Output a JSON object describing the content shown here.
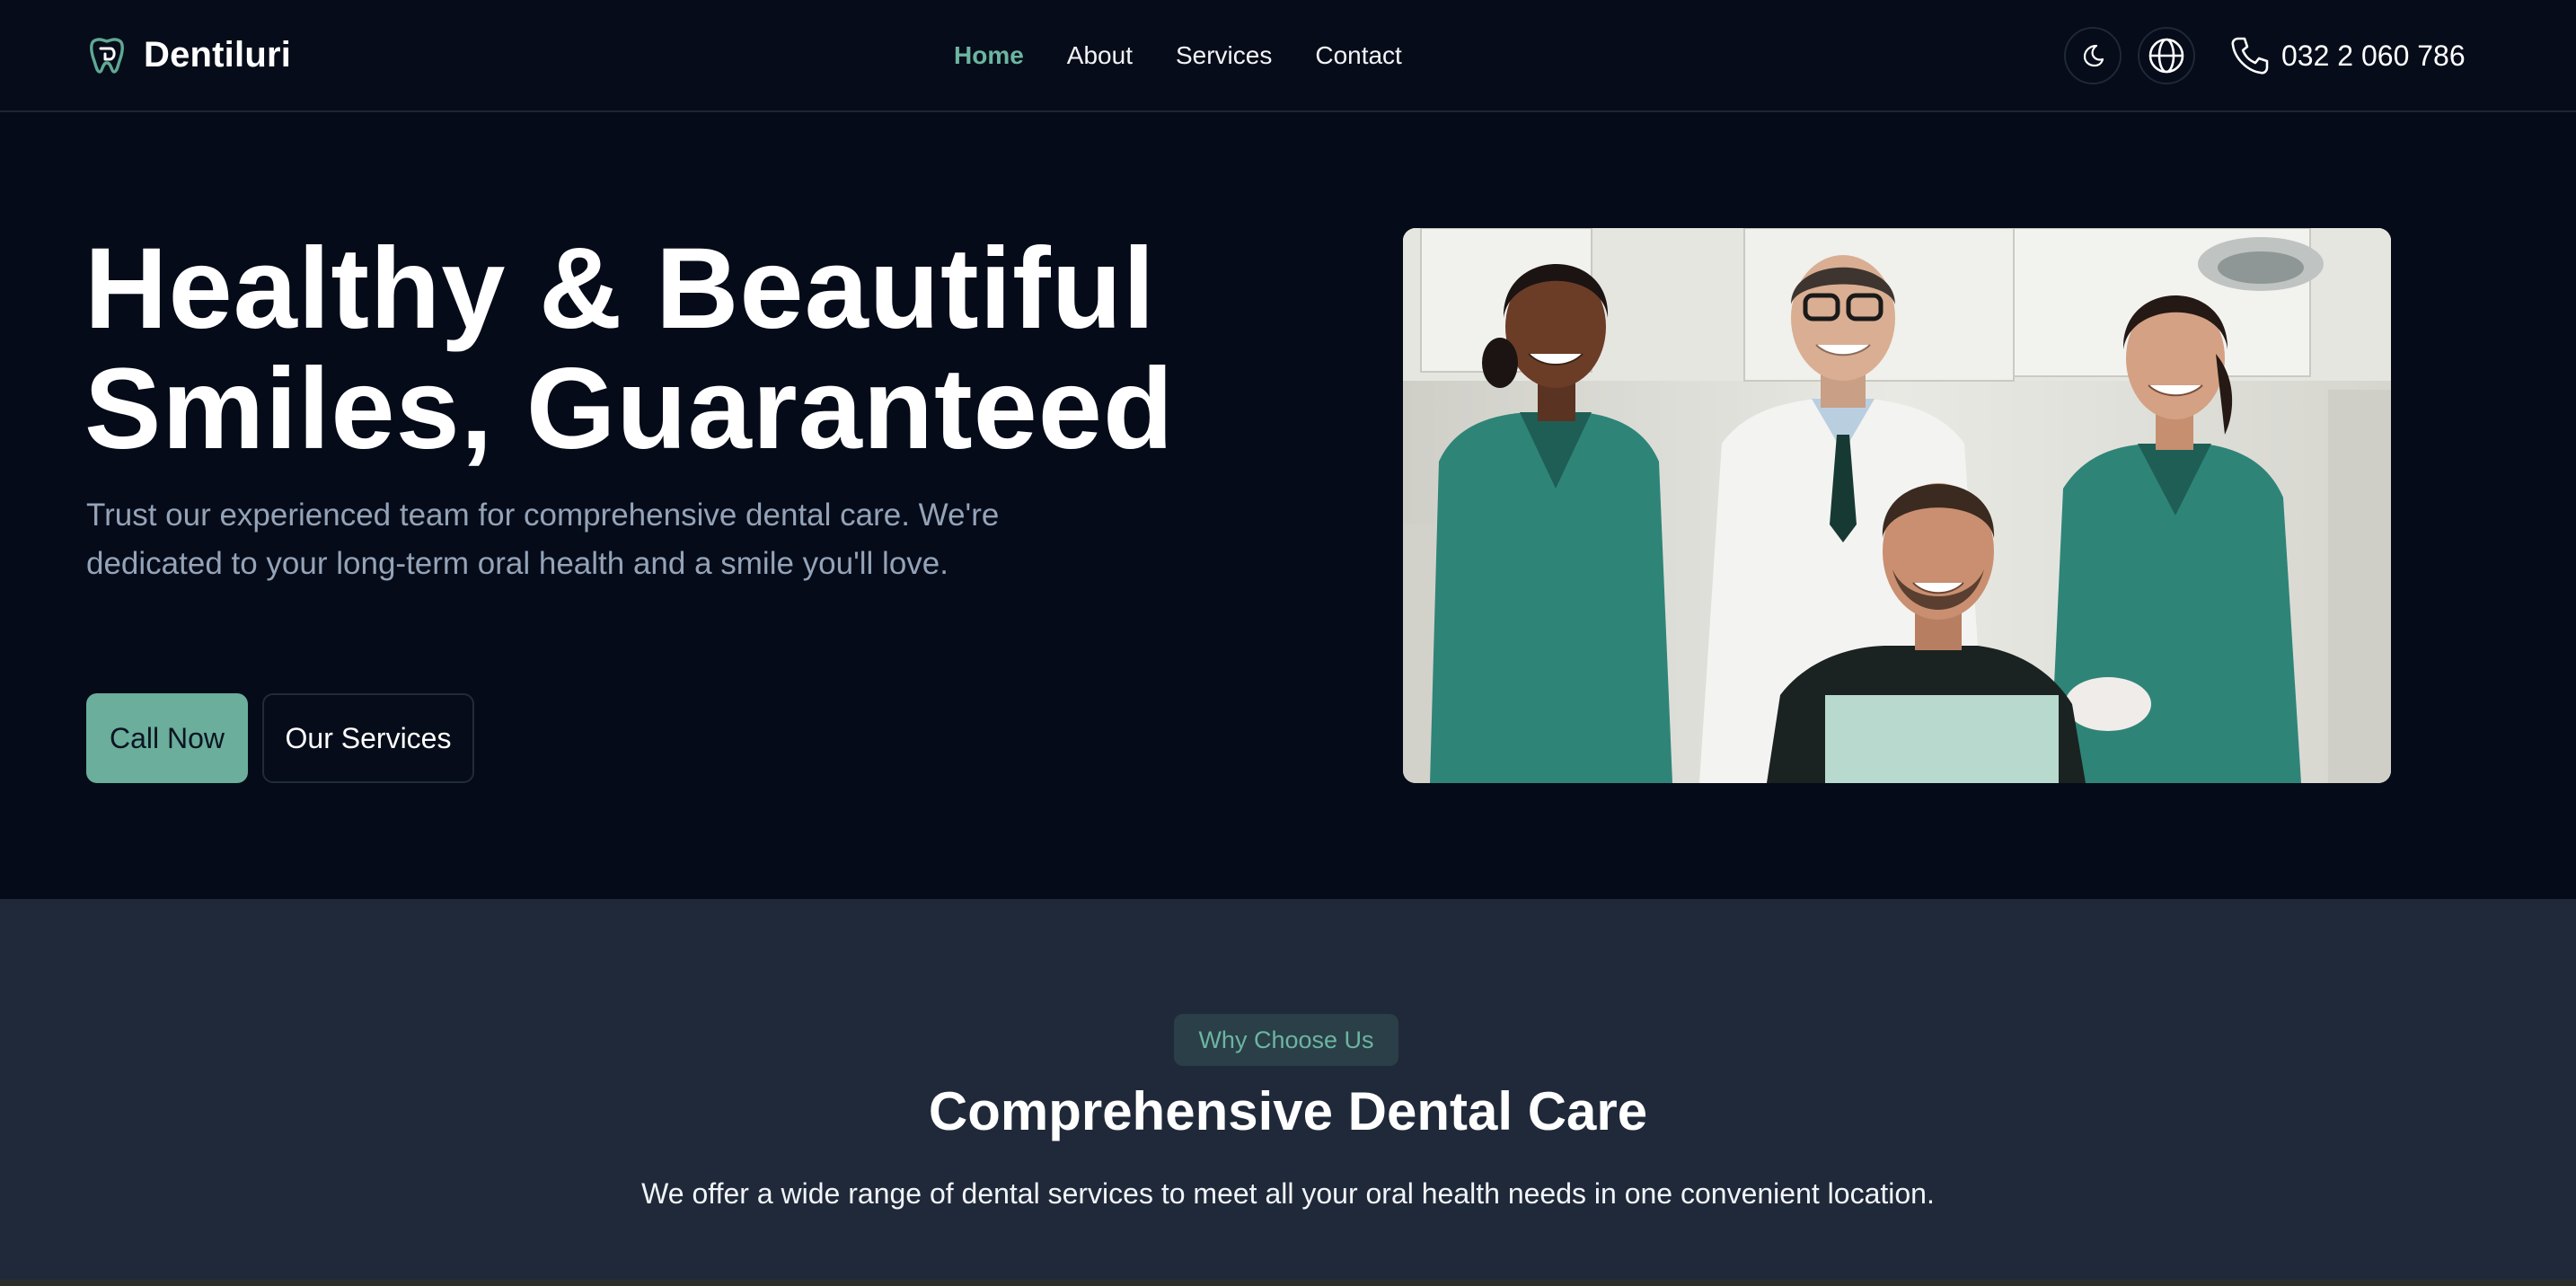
{
  "header": {
    "brand": "Dentiluri",
    "nav": [
      {
        "label": "Home",
        "active": true
      },
      {
        "label": "About",
        "active": false
      },
      {
        "label": "Services",
        "active": false
      },
      {
        "label": "Contact",
        "active": false
      }
    ],
    "theme_icon": "moon-icon",
    "language_icon": "globe-icon",
    "phone_icon": "phone-icon",
    "phone": "032 2 060 786"
  },
  "hero": {
    "title_line1": "Healthy & Beautiful",
    "title_line2": "Smiles, Guaranteed",
    "subtitle": "Trust our experienced team for comprehensive dental care. We're dedicated to your long-term oral health and a smile you'll love.",
    "primary_button": "Call Now",
    "secondary_button": "Our Services",
    "photo": "dental-team-photo"
  },
  "why": {
    "badge": "Why Choose Us",
    "title": "Comprehensive Dental Care",
    "subtitle": "We offer a wide range of dental services to meet all your oral health needs in one convenient location."
  },
  "colors": {
    "accent": "#6cb5a1",
    "page_background": "#050b18",
    "section_background": "#202939",
    "muted_text": "#94a3b8"
  }
}
